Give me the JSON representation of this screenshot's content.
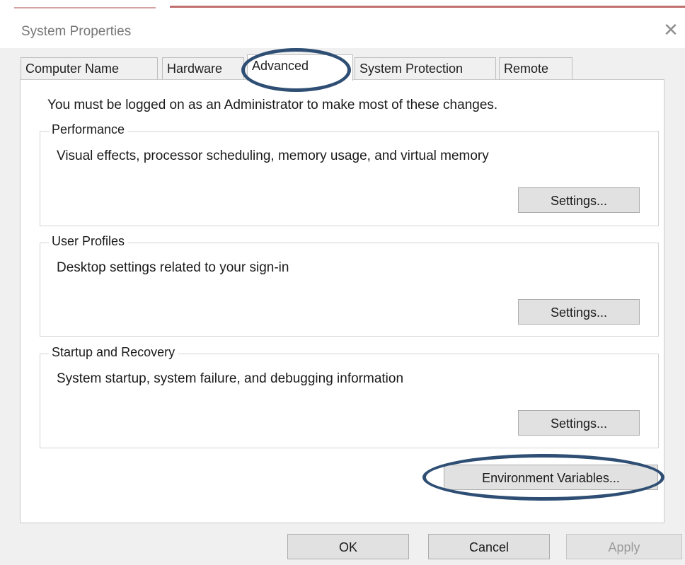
{
  "window": {
    "title": "System Properties",
    "close_icon": "close-icon"
  },
  "tabs": [
    {
      "label": "Computer Name"
    },
    {
      "label": "Hardware"
    },
    {
      "label": "Advanced",
      "selected": true
    },
    {
      "label": "System Protection"
    },
    {
      "label": "Remote"
    }
  ],
  "panel": {
    "notice": "You must be logged on as an Administrator to make most of these changes.",
    "groups": [
      {
        "legend": "Performance",
        "description": "Visual effects, processor scheduling, memory usage, and virtual memory",
        "button": "Settings..."
      },
      {
        "legend": "User Profiles",
        "description": "Desktop settings related to your sign-in",
        "button": "Settings..."
      },
      {
        "legend": "Startup and Recovery",
        "description": "System startup, system failure, and debugging information",
        "button": "Settings..."
      }
    ],
    "env_button": "Environment Variables..."
  },
  "footer": {
    "ok": "OK",
    "cancel": "Cancel",
    "apply": "Apply"
  },
  "colors": {
    "highlight_oval": "#2e4e74",
    "dialog_bg": "#f0f0f0"
  }
}
